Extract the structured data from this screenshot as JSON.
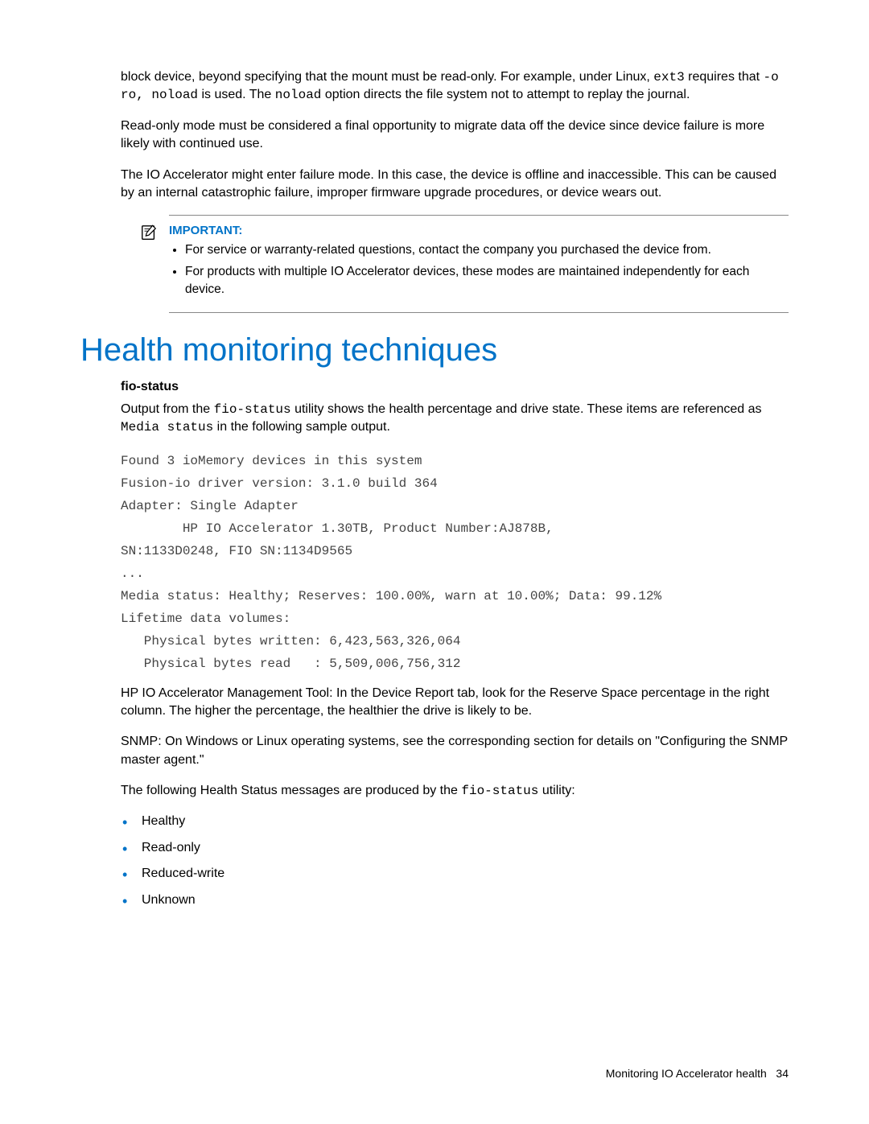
{
  "para1_a": "block device, beyond specifying that the mount must be read-only. For example, under Linux, ",
  "para1_code1": "ext3",
  "para1_b": " requires that ",
  "para1_code2": "-o ro, noload",
  "para1_c": " is used. The ",
  "para1_code3": "noload",
  "para1_d": " option directs the file system not to attempt to replay the journal.",
  "para2": "Read-only mode must be considered a final opportunity to migrate data off the device since device failure is more likely with continued use.",
  "para3": "The IO Accelerator might enter failure mode. In this case, the device is offline and inaccessible. This can be caused by an internal catastrophic failure, improper firmware upgrade procedures, or device wears out.",
  "note": {
    "label": "IMPORTANT:",
    "items": [
      "For service or warranty-related questions, contact the company you purchased the device from.",
      "For products with multiple IO Accelerator devices, these modes are maintained independently for each device."
    ]
  },
  "heading": "Health monitoring techniques",
  "sub_heading": "fio-status",
  "para4_a": "Output from the ",
  "para4_code1": "fio-status",
  "para4_b": " utility shows the health percentage and drive state. These items are referenced as ",
  "para4_code2": "Media status",
  "para4_c": " in the following sample output.",
  "code_lines": [
    "Found 3 ioMemory devices in this system",
    "Fusion-io driver version: 3.1.0 build 364",
    "Adapter: Single Adapter",
    "        HP IO Accelerator 1.30TB, Product Number:AJ878B,",
    "SN:1133D0248, FIO SN:1134D9565",
    "...",
    "Media status: Healthy; Reserves: 100.00%, warn at 10.00%; Data: 99.12%",
    "Lifetime data volumes:",
    "   Physical bytes written: 6,423,563,326,064",
    "   Physical bytes read   : 5,509,006,756,312"
  ],
  "para5": "HP IO Accelerator Management Tool: In the Device Report tab, look for the Reserve Space percentage in the right column. The higher the percentage, the healthier the drive is likely to be.",
  "para6": "SNMP: On Windows or Linux operating systems, see the corresponding section for details on \"Configuring the SNMP master agent.\"",
  "para7_a": "The following Health Status messages are produced by the ",
  "para7_code1": "fio-status",
  "para7_b": " utility:",
  "status_list": [
    "Healthy",
    "Read-only",
    "Reduced-write",
    "Unknown"
  ],
  "footer_text": "Monitoring IO Accelerator health",
  "footer_page": "34"
}
